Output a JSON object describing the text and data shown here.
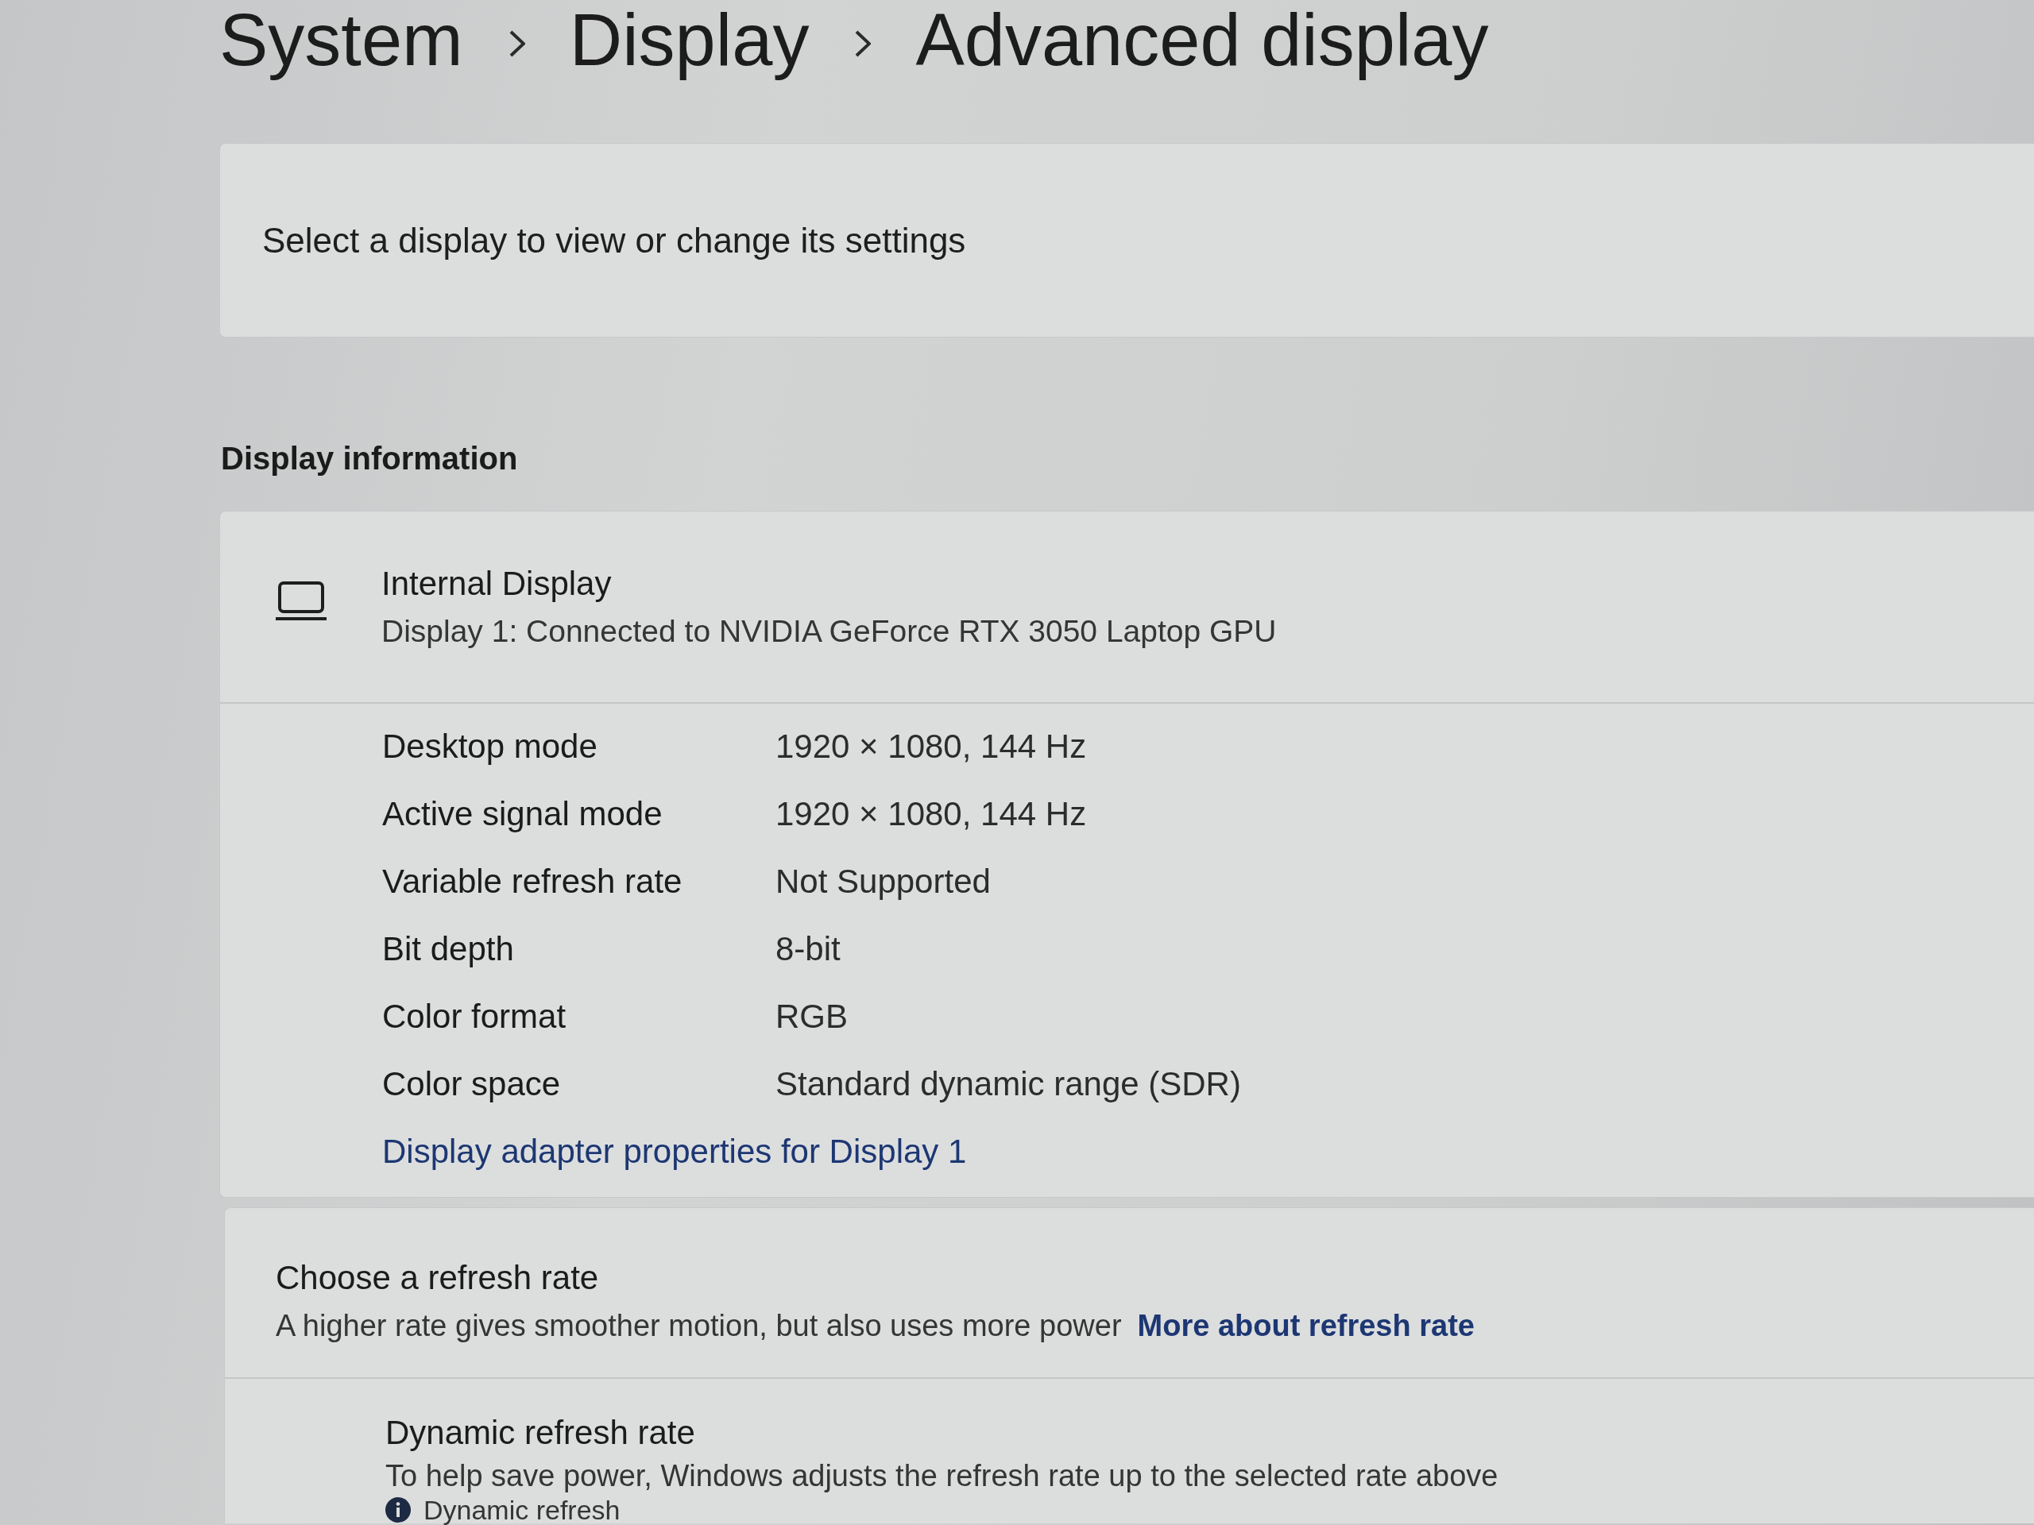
{
  "breadcrumb": [
    {
      "label": "System"
    },
    {
      "label": "Display"
    },
    {
      "label": "Advanced display"
    }
  ],
  "display_selector": {
    "text": "Select a display to view or change its settings"
  },
  "display_information": {
    "heading": "Display information",
    "display": {
      "name": "Internal Display",
      "description": "Display 1: Connected to NVIDIA GeForce RTX 3050 Laptop GPU"
    },
    "properties": [
      {
        "label": "Desktop mode",
        "value": "1920 × 1080, 144 Hz"
      },
      {
        "label": "Active signal mode",
        "value": "1920 × 1080, 144 Hz"
      },
      {
        "label": "Variable refresh rate",
        "value": "Not Supported"
      },
      {
        "label": "Bit depth",
        "value": "8-bit"
      },
      {
        "label": "Color format",
        "value": "RGB"
      },
      {
        "label": "Color space",
        "value": "Standard dynamic range (SDR)"
      }
    ],
    "link": "Display adapter properties for Display 1"
  },
  "refresh_rate": {
    "title": "Choose a refresh rate",
    "description": "A higher rate gives smoother motion, but also uses more power",
    "link": "More about refresh rate",
    "dynamic_refresh_rate": {
      "title": "Dynamic refresh rate",
      "description": "To help save power, Windows adjusts the refresh rate up to the selected rate above",
      "note": "Dynamic refresh"
    }
  }
}
